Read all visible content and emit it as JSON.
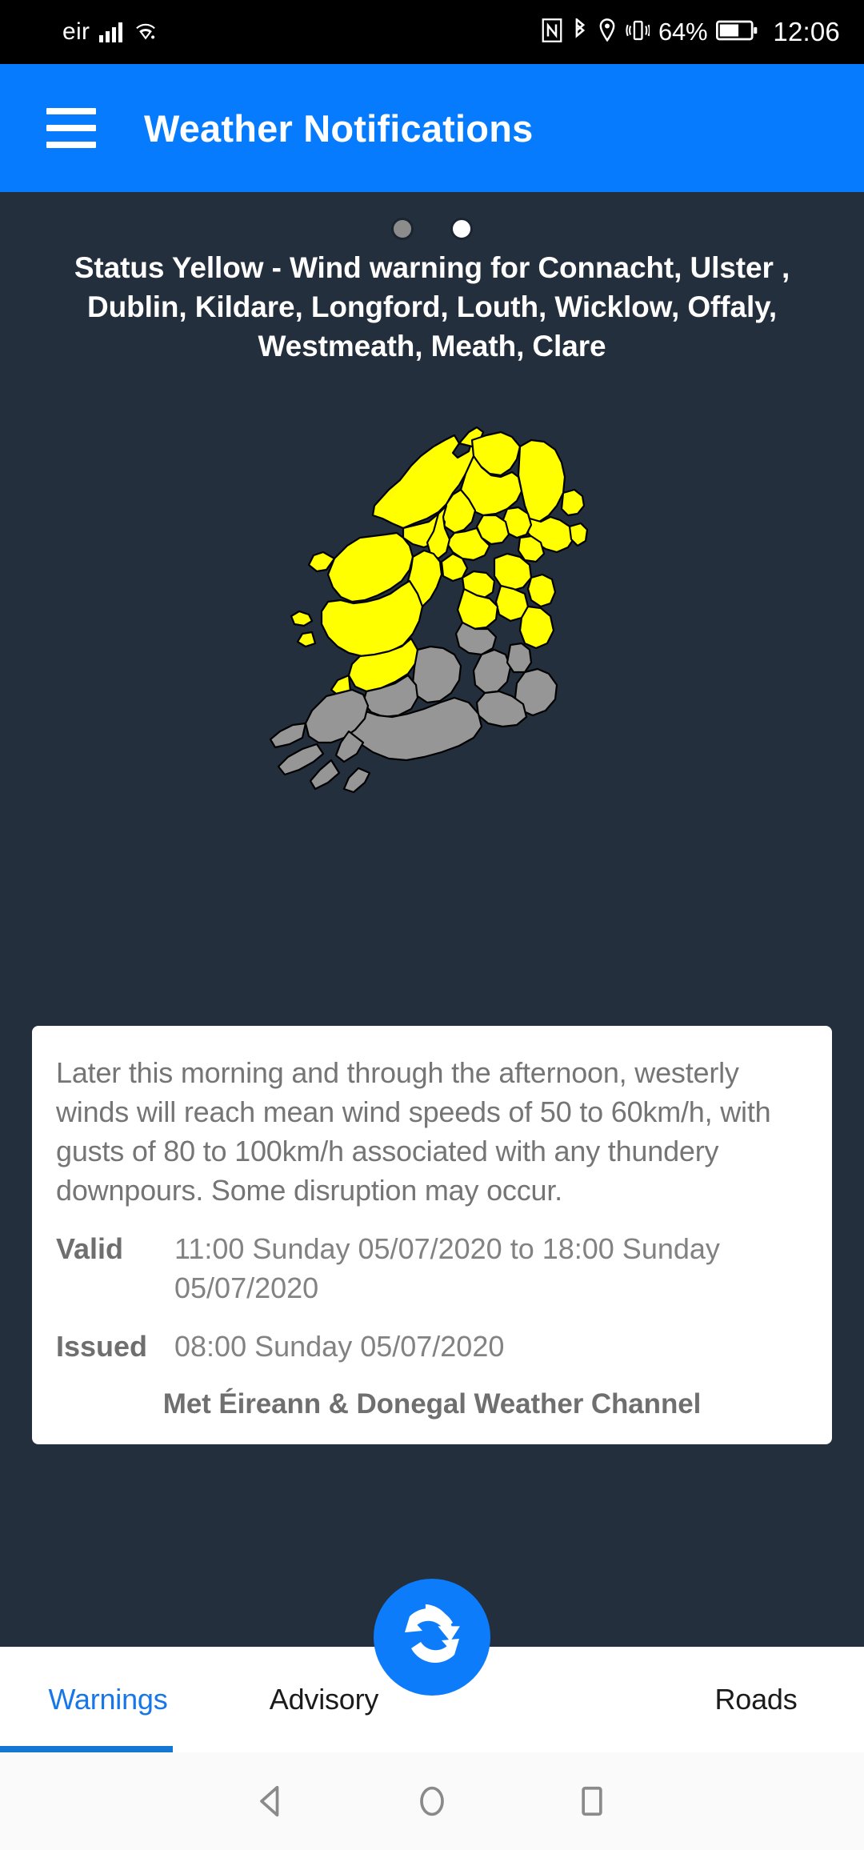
{
  "statusbar": {
    "carrier": "eir",
    "icons": [
      "signal-icon",
      "wifi-icon",
      "nfc-icon",
      "bluetooth-icon",
      "location-icon",
      "vibrate-icon"
    ],
    "battery_percent": "64%",
    "time": "12:06"
  },
  "appbar": {
    "menu_icon": "hamburger-menu-icon",
    "title": "Weather Notifications",
    "background_color": "#067BFD"
  },
  "pager": {
    "dots": [
      {
        "state": "inactive",
        "color": "#8C8C8C"
      },
      {
        "state": "active",
        "color": "#FFFFFF"
      }
    ]
  },
  "warning": {
    "headline": "Status Yellow - Wind warning for Connacht, Ulster , Dublin, Kildare, Longford, Louth, Wicklow, Offaly, Westmeath, Meath, Clare",
    "level_color": "#FFFF00",
    "map": {
      "alt": "Map of Ireland with warning counties highlighted",
      "warning_fill": "#FFFF00",
      "normal_fill": "#969696",
      "border_color": "#000000"
    },
    "body": "Later this morning and through the afternoon, westerly winds will reach mean wind speeds of 50 to 60km/h, with gusts of 80 to 100km/h associated with any thundery downpours. Some disruption may occur.",
    "valid_label": "Valid",
    "valid_value": "11:00 Sunday 05/07/2020 to 18:00 Sunday 05/07/2020",
    "issued_label": "Issued",
    "issued_value": "08:00 Sunday 05/07/2020",
    "attribution": "Met Éireann & Donegal Weather Channel"
  },
  "fab": {
    "icon": "refresh-icon",
    "color": "#0D7CFB"
  },
  "tabs": [
    {
      "label": "Warnings",
      "active": true
    },
    {
      "label": "Advisory",
      "active": false
    },
    {
      "label": "Roads",
      "active": false
    }
  ],
  "navbar": {
    "back": "back-icon",
    "home": "home-icon",
    "recents": "recents-icon"
  }
}
